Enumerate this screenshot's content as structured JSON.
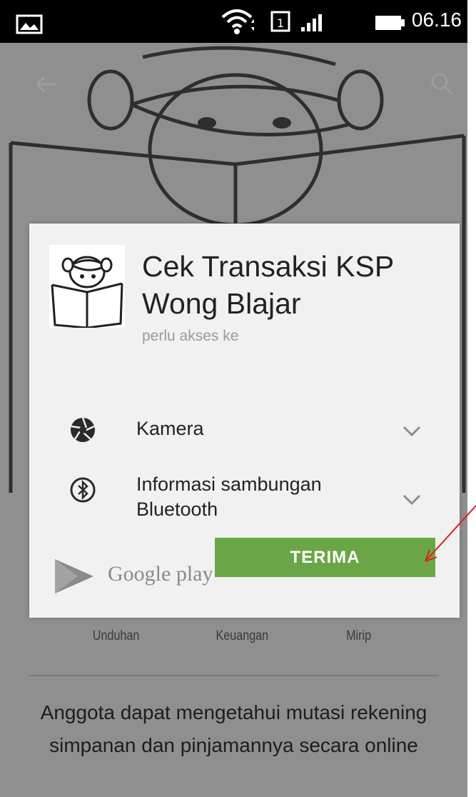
{
  "status_bar": {
    "time": "06.16"
  },
  "background": {
    "tabs": [
      "Unduhan",
      "Keuangan",
      "Mirip"
    ],
    "description": "Anggota dapat mengetahui mutasi rekening simpanan dan pinjamannya secara online"
  },
  "dialog": {
    "app_title_line1": "Cek Transaksi KSP",
    "app_title_line2": "Wong Blajar",
    "subtitle": "perlu akses ke",
    "permissions": [
      {
        "icon": "camera-aperture-icon",
        "label": "Kamera"
      },
      {
        "icon": "bluetooth-icon",
        "label_line1": "Informasi sambungan",
        "label_line2": "Bluetooth"
      }
    ],
    "brand": "Google play",
    "accept_label": "TERIMA"
  },
  "colors": {
    "accept": "#6ba646",
    "scrim": "#8f8f8f",
    "dialog": "#f1f1f1",
    "annotation": "#e02020"
  }
}
